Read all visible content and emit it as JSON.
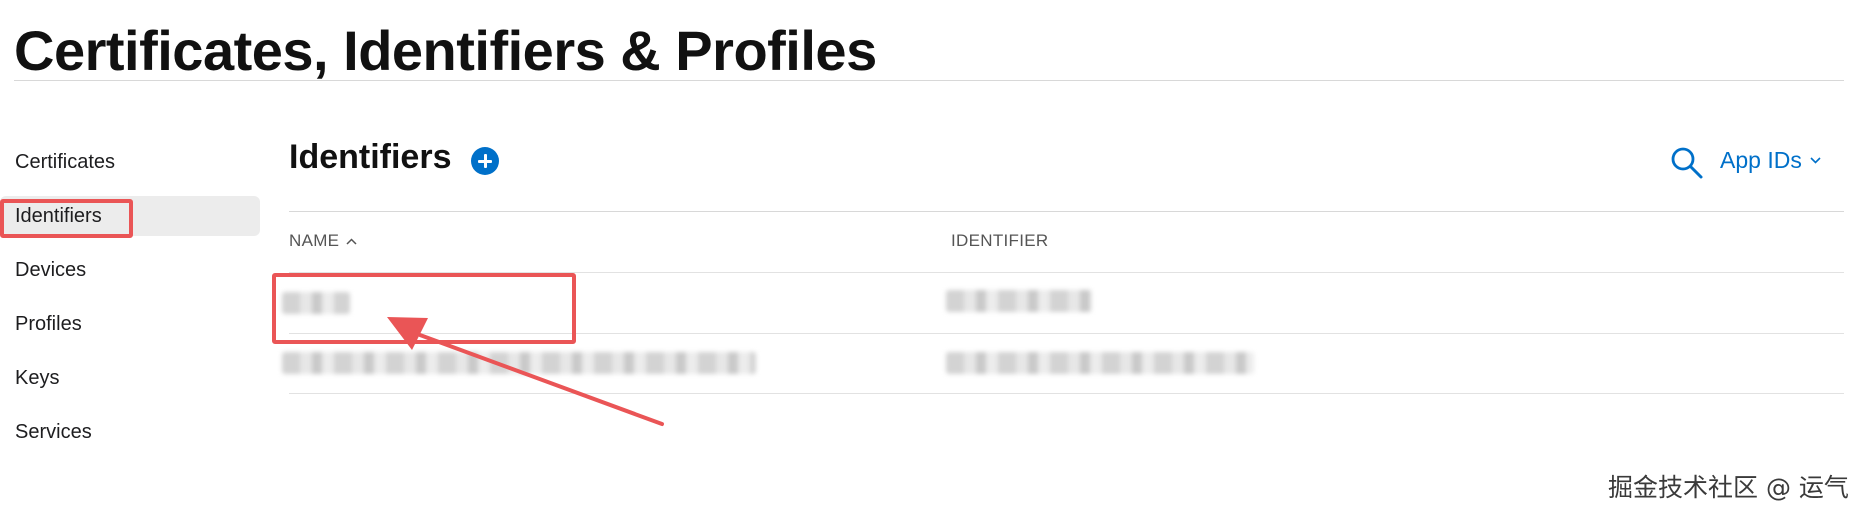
{
  "page": {
    "title": "Certificates, Identifiers & Profiles"
  },
  "sidebar": {
    "items": [
      {
        "label": "Certificates"
      },
      {
        "label": "Identifiers",
        "active": true
      },
      {
        "label": "Devices"
      },
      {
        "label": "Profiles"
      },
      {
        "label": "Keys"
      },
      {
        "label": "Services"
      }
    ]
  },
  "main": {
    "section_title": "Identifiers",
    "add_icon": "plus-circle-icon",
    "search_icon": "search-icon",
    "filter": {
      "selected": "App IDs",
      "icon": "chevron-down-icon"
    },
    "table": {
      "columns": [
        {
          "label": "NAME",
          "sort": "ascending"
        },
        {
          "label": "IDENTIFIER"
        }
      ],
      "rows": [
        {
          "name": "",
          "identifier": "",
          "blurred": true
        },
        {
          "name": "",
          "identifier": "",
          "blurred": true
        }
      ]
    }
  },
  "annotations": {
    "color": "#ea5556",
    "highlights": [
      "sidebar-identifiers",
      "first-row-name"
    ],
    "arrow": "points-to-first-row"
  },
  "watermark": "掘金技术社区 @ 运气",
  "colors": {
    "accent": "#0070c9",
    "annotation": "#ea5556",
    "sidebar_active_bg": "#ececec"
  }
}
